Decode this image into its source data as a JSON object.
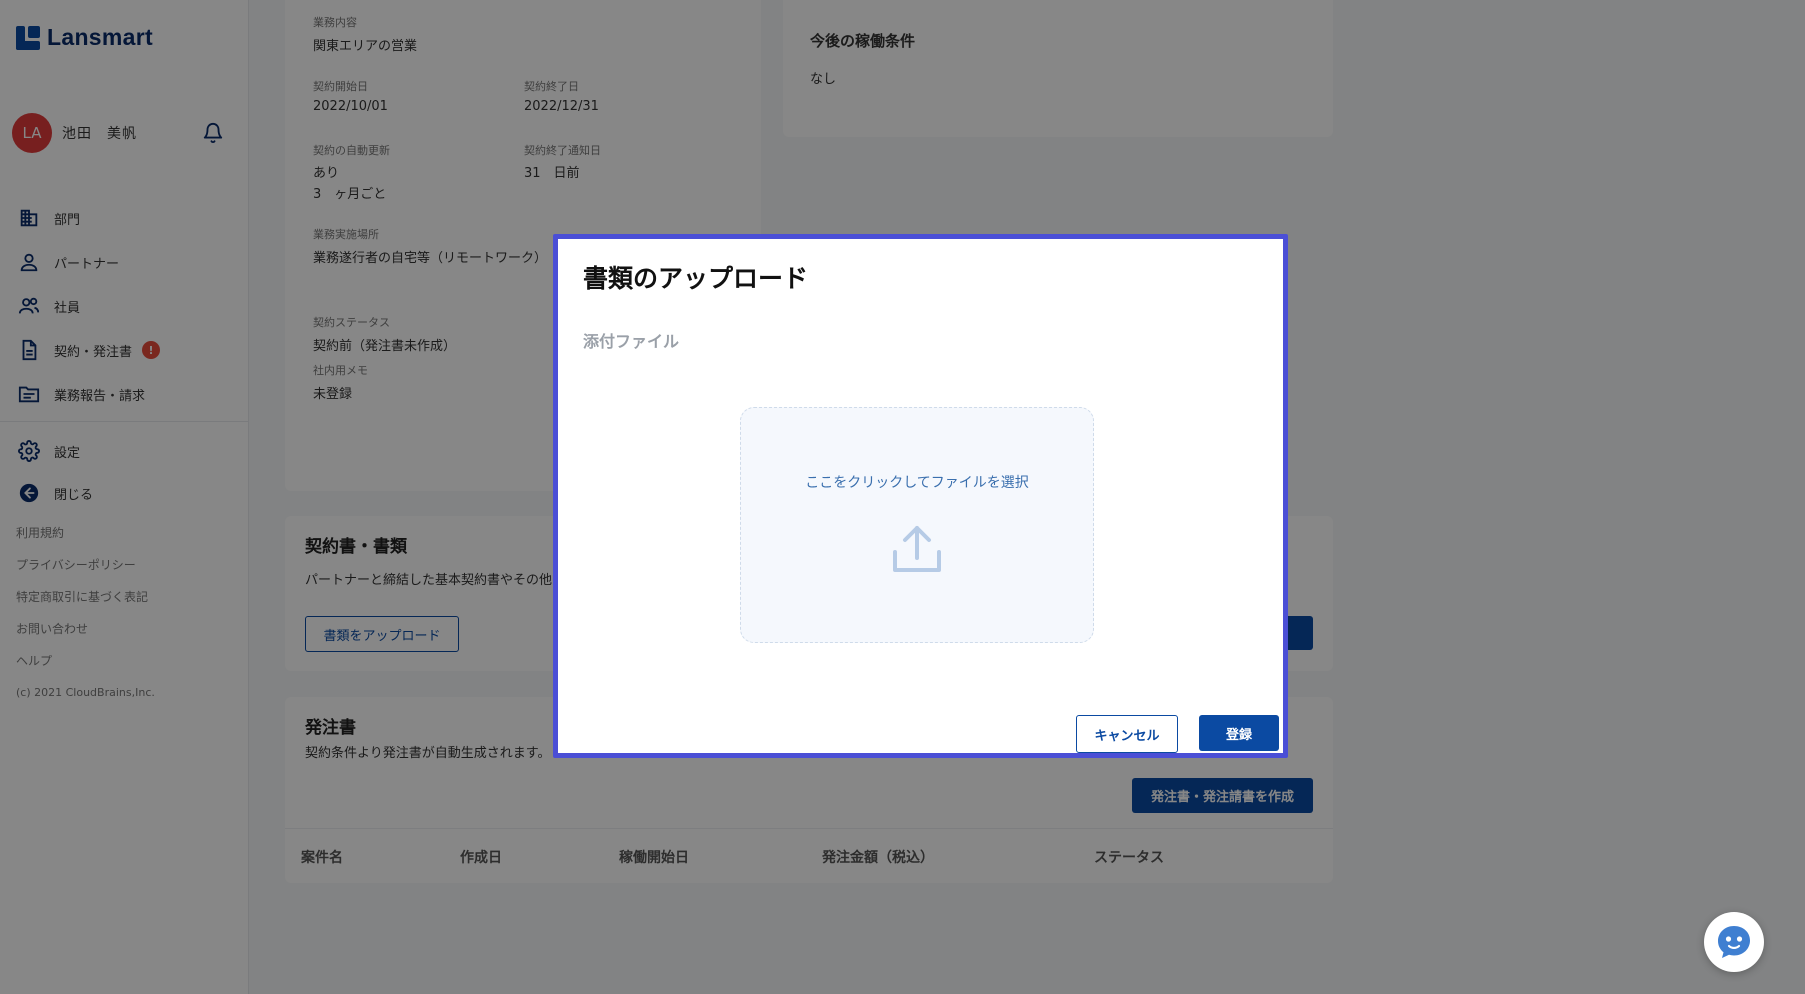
{
  "brand": {
    "logo_text": "Lansmart",
    "accent": "#0b4aa2"
  },
  "user": {
    "initials": "LA",
    "name": "池田　美帆",
    "avatar_color": "#e03c3c"
  },
  "sidebar": {
    "nav": [
      {
        "label": "部門",
        "icon": "building-icon"
      },
      {
        "label": "パートナー",
        "icon": "person-icon"
      },
      {
        "label": "社員",
        "icon": "people-icon"
      },
      {
        "label": "契約・発注書",
        "icon": "document-icon",
        "badge": "!"
      },
      {
        "label": "業務報告・請求",
        "icon": "folder-icon"
      }
    ],
    "settings": {
      "label": "設定",
      "icon": "gear-icon"
    },
    "close": {
      "label": "閉じる",
      "icon": "arrow-left-circle-icon"
    },
    "links": [
      "利用規約",
      "プライバシーポリシー",
      "特定商取引に基づく表記",
      "お問い合わせ",
      "ヘルプ"
    ],
    "copyright": "(c) 2021 CloudBrains,Inc."
  },
  "contract": {
    "business_label": "業務内容",
    "business_value": "関東エリアの営業",
    "start_label": "契約開始日",
    "start_value": "2022/10/01",
    "end_label": "契約終了日",
    "end_value": "2022/12/31",
    "auto_renew_label": "契約の自動更新",
    "auto_renew_value": "あり",
    "auto_renew_period": "3　ヶ月ごと",
    "end_notice_label": "契約終了通知日",
    "end_notice_value": "31　日前",
    "location_label": "業務実施場所",
    "location_value": "業務遂行者の自宅等（リモートワーク）",
    "status_label": "契約ステータス",
    "status_value": "契約前（発注書未作成）",
    "memo_label": "社内用メモ",
    "memo_value": "未登録"
  },
  "future_conditions": {
    "title": "今後の稼働条件",
    "value": "なし"
  },
  "documents": {
    "title": "契約書・書類",
    "description": "パートナーと締結した基本契約書やその他",
    "upload_button": "書類をアップロード"
  },
  "orders": {
    "title": "発注書",
    "description": "契約条件より発注書が自動生成されます。",
    "create_button": "発注書・発注請書を作成",
    "columns": [
      "案件名",
      "作成日",
      "稼働開始日",
      "発注金額（税込）",
      "ステータス"
    ]
  },
  "modal": {
    "title": "書類のアップロード",
    "section_label": "添付ファイル",
    "dropzone_text": "ここをクリックしてファイルを選択",
    "cancel_label": "キャンセル",
    "submit_label": "登録",
    "border_color": "#4b4fd6"
  }
}
